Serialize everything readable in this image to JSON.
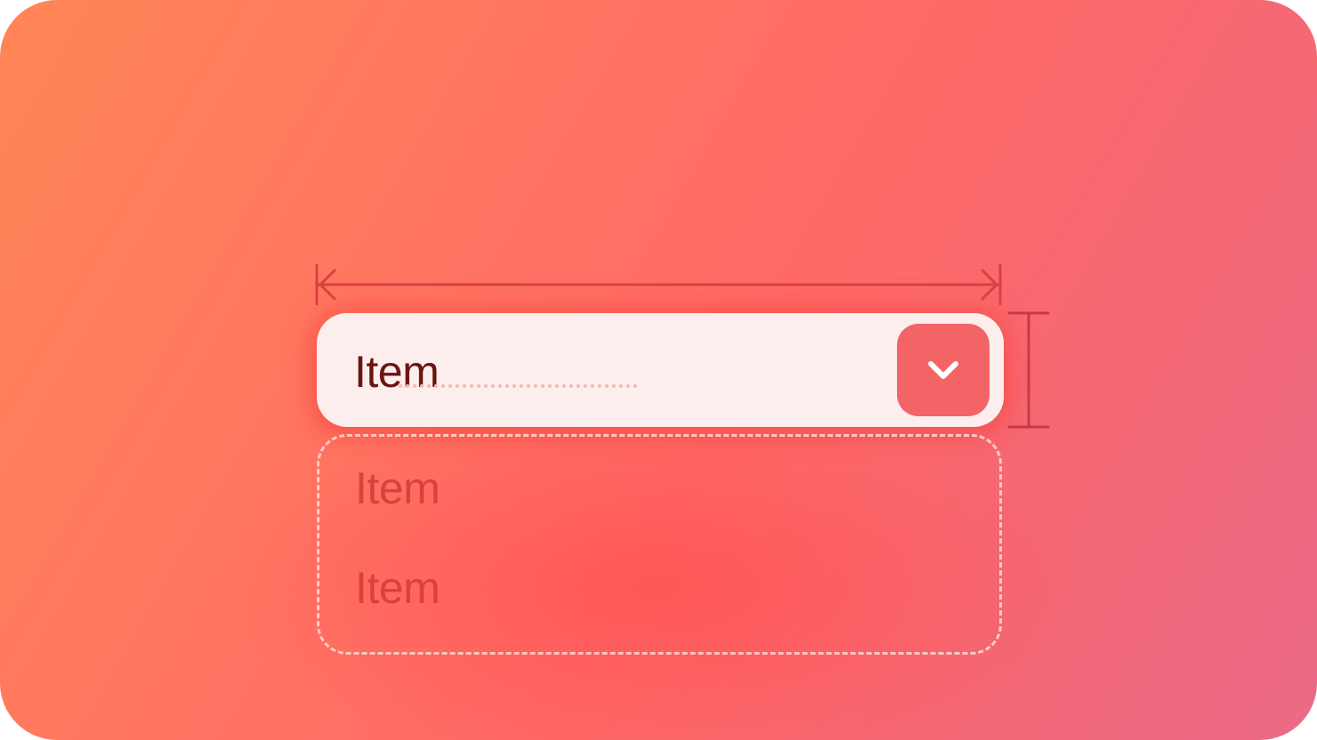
{
  "select": {
    "selected_value": "Item",
    "chevron_icon": "chevron-down-icon"
  },
  "menu": {
    "items": [
      {
        "label": "Item"
      },
      {
        "label": "Item"
      }
    ]
  },
  "colors": {
    "background_start": "#ff8656",
    "background_end": "#ec6a88",
    "select_fill": "#fdeeee",
    "label_text": "#6b1410",
    "chevron_button": "#f26466",
    "menu_item_text": "#d9413a",
    "measure_lines": "#d8423f"
  }
}
